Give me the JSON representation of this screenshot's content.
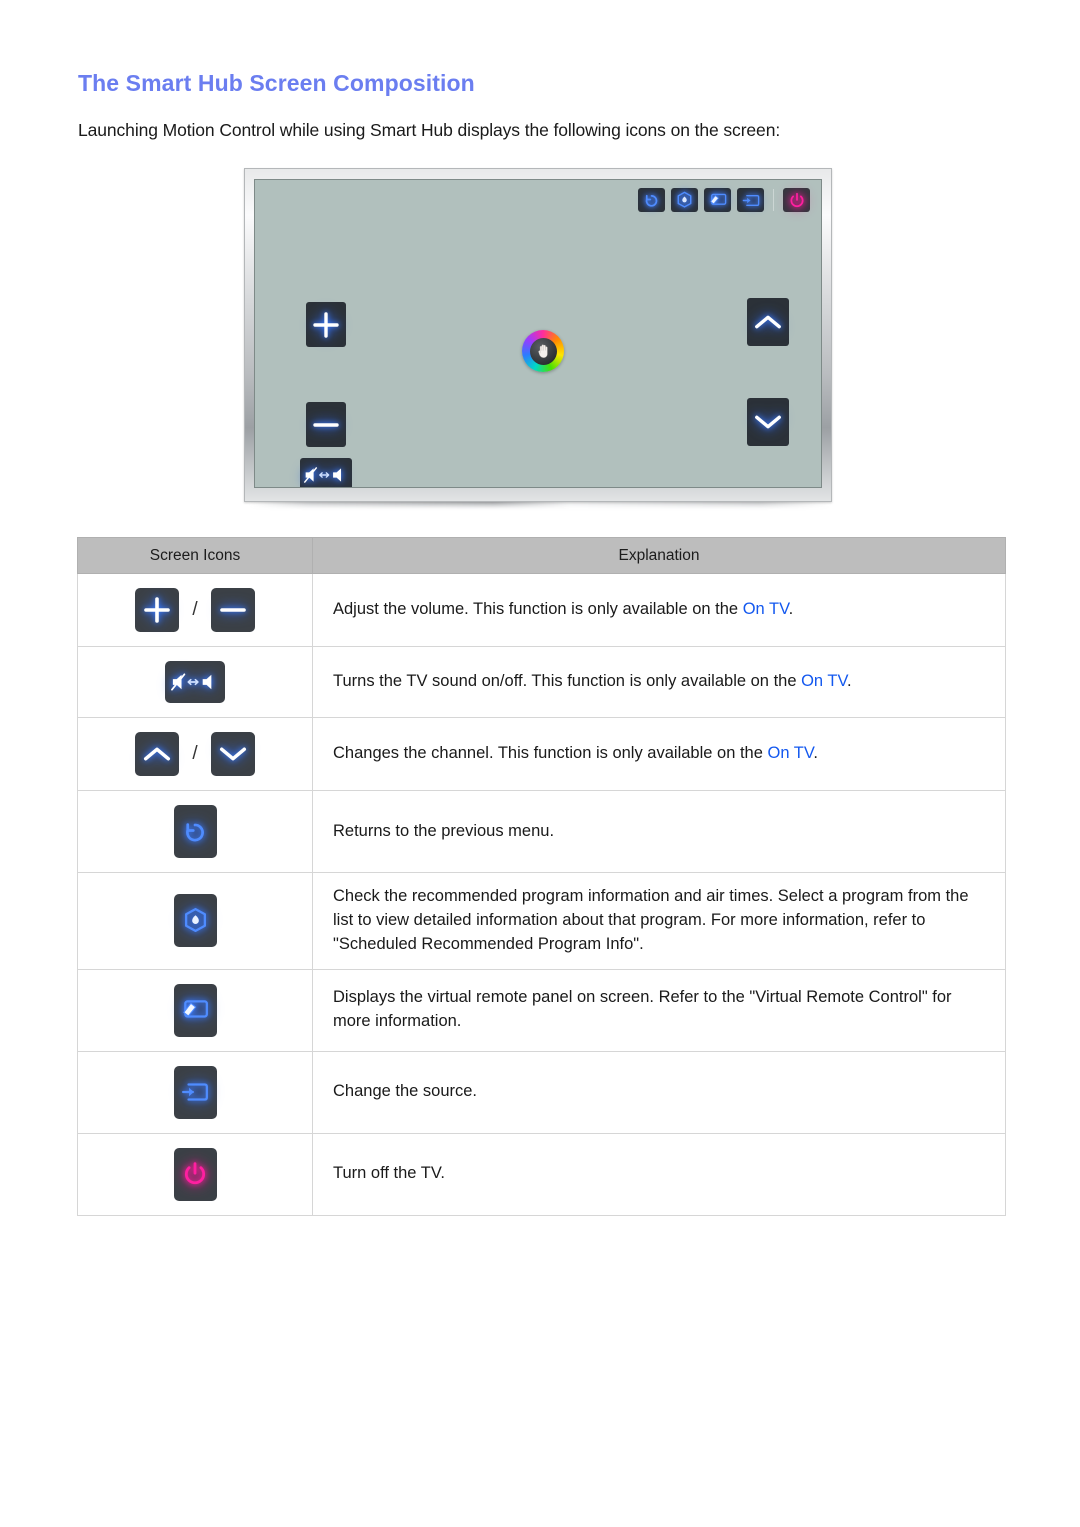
{
  "document": {
    "title": "The Smart Hub Screen Composition",
    "intro": "Launching Motion Control while using Smart Hub displays the following icons on the screen:"
  },
  "colors": {
    "title_blue": "#6b7ef0",
    "link_blue": "#1358ef",
    "icon_glow_blue": "#3d7dff",
    "icon_glow_pink": "#ff1fa0",
    "chip_background": "#3b4046",
    "tv_screen": "#b1c0bd",
    "table_header": "#bdbdbd"
  },
  "tv_mockup": {
    "name": "smart-hub-motion-control-screen",
    "top_bar_icons": [
      {
        "name": "return-icon",
        "label": "Return"
      },
      {
        "name": "recommended-program-icon",
        "label": "Recommended"
      },
      {
        "name": "virtual-remote-icon",
        "label": "Virtual Remote"
      },
      {
        "name": "source-icon",
        "label": "Source"
      },
      {
        "name": "power-icon",
        "label": "Power"
      }
    ],
    "left_icons": [
      {
        "name": "volume-up-icon",
        "label": "Volume Up"
      },
      {
        "name": "volume-down-icon",
        "label": "Volume Down"
      },
      {
        "name": "mute-toggle-icon",
        "label": "Mute On/Off"
      }
    ],
    "right_icons": [
      {
        "name": "channel-up-icon",
        "label": "Channel Up"
      },
      {
        "name": "channel-down-icon",
        "label": "Channel Down"
      }
    ],
    "center_pointer": {
      "name": "hand-pointer-icon",
      "label": "Motion Control Hand Pointer"
    }
  },
  "table": {
    "headers": {
      "icons": "Screen Icons",
      "explanation": "Explanation"
    },
    "rows": [
      {
        "icons": [
          "volume-up-icon",
          "volume-down-icon"
        ],
        "text_before": "Adjust the volume. This function is only available on the ",
        "link": "On TV",
        "text_after": "."
      },
      {
        "icons": [
          "mute-toggle-icon"
        ],
        "text_before": "Turns the TV sound on/off. This function is only available on the ",
        "link": "On TV",
        "text_after": "."
      },
      {
        "icons": [
          "channel-up-icon",
          "channel-down-icon"
        ],
        "text_before": "Changes the channel. This function is only available on the ",
        "link": "On TV",
        "text_after": "."
      },
      {
        "icons": [
          "return-icon"
        ],
        "text_before": "Returns to the previous menu.",
        "link": "",
        "text_after": ""
      },
      {
        "icons": [
          "recommended-program-icon"
        ],
        "text_before": "Check the recommended program information and air times. Select a program from the list to view detailed information about that program. For more information, refer to \"Scheduled Recommended Program Info\".",
        "link": "",
        "text_after": ""
      },
      {
        "icons": [
          "virtual-remote-icon"
        ],
        "text_before": "Displays the virtual remote panel on screen. Refer to the \"Virtual Remote Control\" for more information.",
        "link": "",
        "text_after": ""
      },
      {
        "icons": [
          "source-icon"
        ],
        "text_before": "Change the source.",
        "link": "",
        "text_after": ""
      },
      {
        "icons": [
          "power-icon"
        ],
        "text_before": "Turn off the TV.",
        "link": "",
        "text_after": ""
      }
    ],
    "separator": "/"
  }
}
